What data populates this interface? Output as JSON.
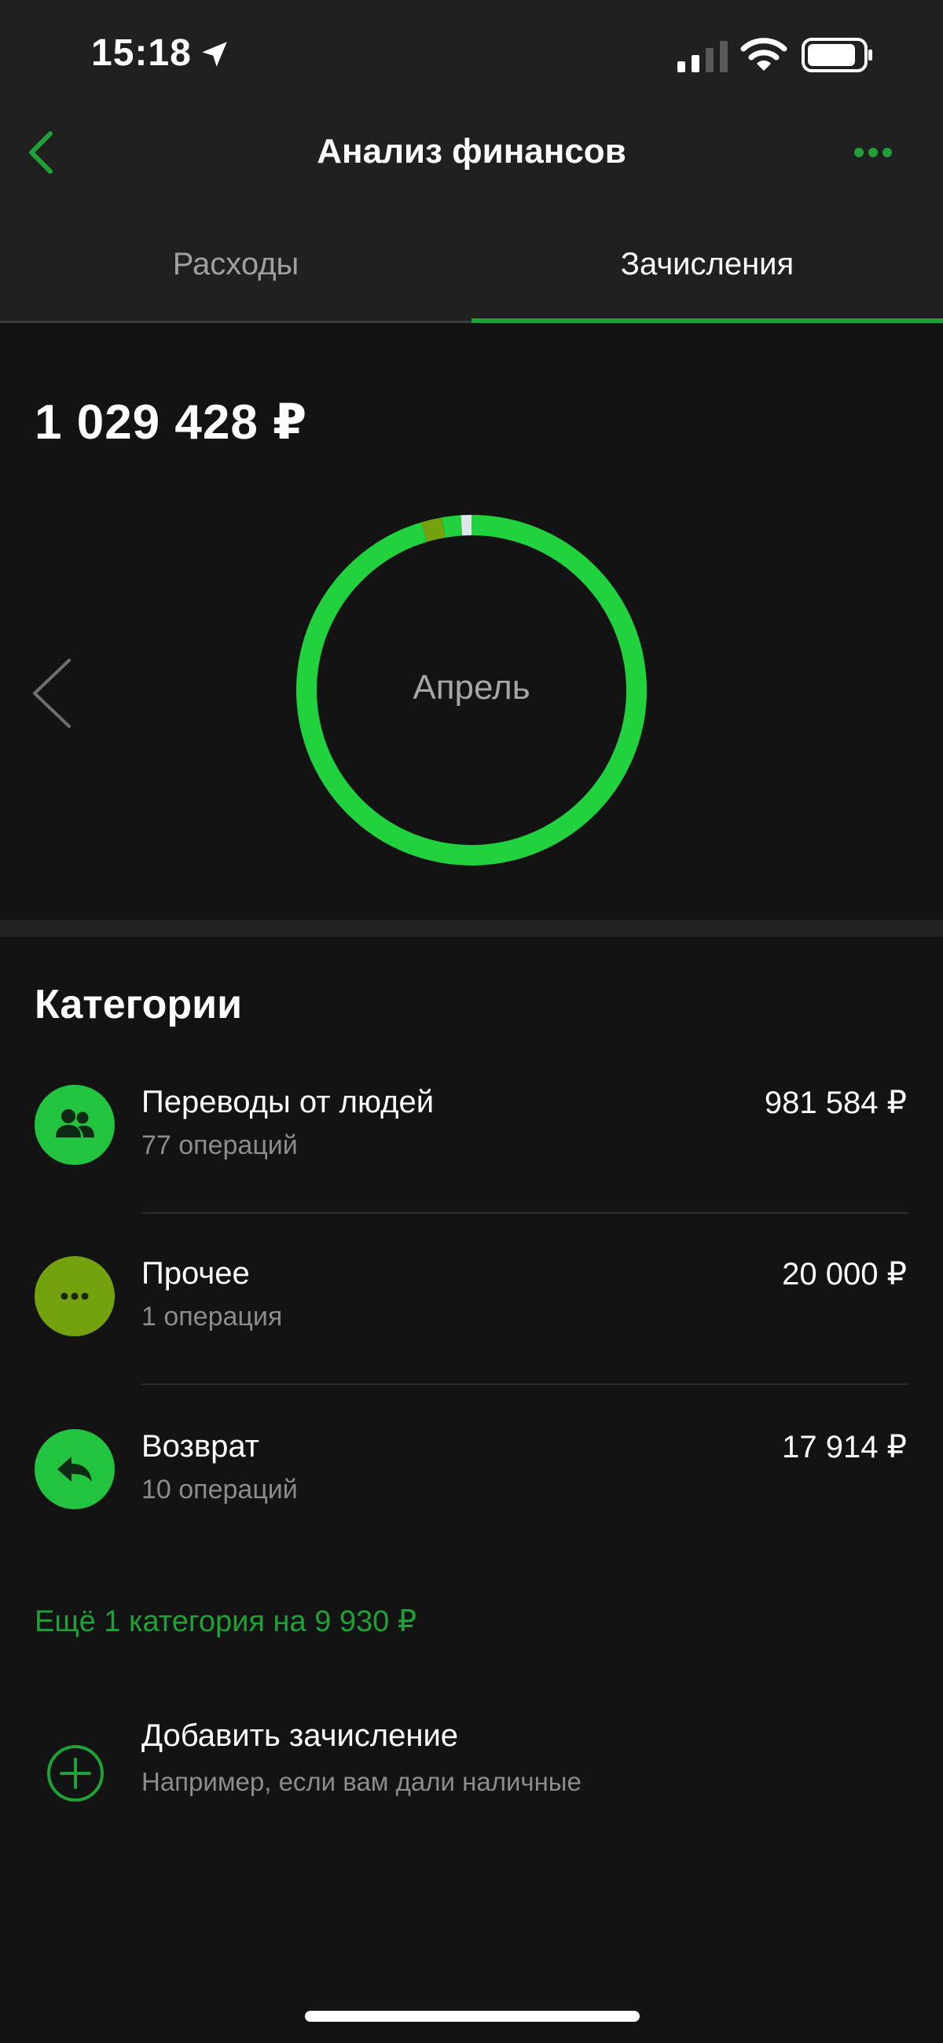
{
  "status_bar": {
    "time": "15:18"
  },
  "header": {
    "title": "Анализ финансов"
  },
  "tabs": [
    {
      "label": "Расходы",
      "active": false
    },
    {
      "label": "Зачисления",
      "active": true
    }
  ],
  "summary": {
    "total": "1 029 428 ₽",
    "month": "Апрель"
  },
  "categories_title": "Категории",
  "categories": [
    {
      "name": "Переводы от людей",
      "count": "77 операций",
      "amount": "981 584 ₽",
      "icon": "people-icon",
      "color": "#21c33f"
    },
    {
      "name": "Прочее",
      "count": "1 операция",
      "amount": "20 000 ₽",
      "icon": "dots-icon",
      "color": "#74a10e"
    },
    {
      "name": "Возврат",
      "count": "10 операций",
      "amount": "17 914 ₽",
      "icon": "return-arrow-icon",
      "color": "#21c33f"
    }
  ],
  "more_categories": "Ещё 1 категория на 9 930 ₽",
  "add_income": {
    "title": "Добавить зачисление",
    "subtitle": "Например, если вам дали наличные"
  },
  "colors": {
    "accent": "#21a038",
    "ring_main": "#21d13d",
    "ring_other": "#74a10e",
    "ring_rest": "#dfe6ea",
    "background": "#131313"
  },
  "chart_data": {
    "type": "pie",
    "categories": [
      "Переводы от людей",
      "Прочее",
      "Возврат",
      "Ещё 1 категория"
    ],
    "values": [
      981584,
      20000,
      17914,
      9930
    ]
  }
}
